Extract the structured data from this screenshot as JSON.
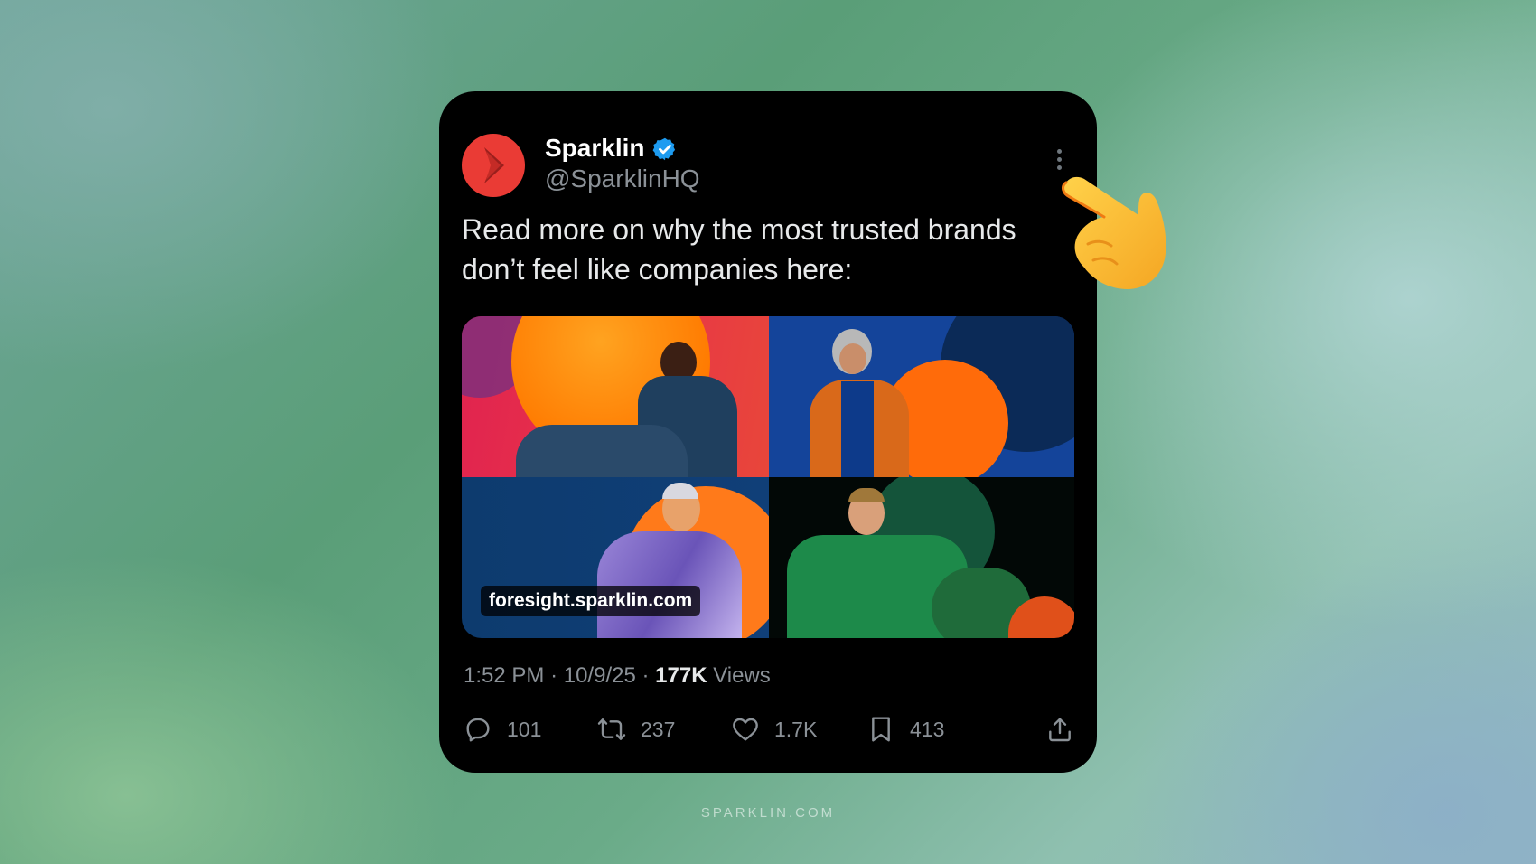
{
  "tweet": {
    "author": {
      "name": "Sparklin",
      "handle": "@SparklinHQ",
      "verified": true,
      "avatar_color": "#ea3b35",
      "avatar_icon": "chevron-right-icon"
    },
    "text": "Read more on why the most trusted brands don’t feel like companies here:",
    "link_card": {
      "domain": "foresight.sparklin.com",
      "image_description": "four-panel collage of people on colorful backgrounds"
    },
    "meta": {
      "time": "1:52 PM",
      "separator": "·",
      "date": "10/9/25",
      "views_count": "177K",
      "views_label": "Views"
    },
    "actions": {
      "replies": "101",
      "reposts": "237",
      "likes": "1.7K",
      "bookmarks": "413"
    }
  },
  "footer": {
    "text": "SPARKLIN.COM"
  },
  "colors": {
    "card_bg": "#000000",
    "text_primary": "#e7e9ea",
    "text_secondary": "#8b9197",
    "verified_blue": "#1d9bf0",
    "brand_red": "#ea3b35"
  }
}
